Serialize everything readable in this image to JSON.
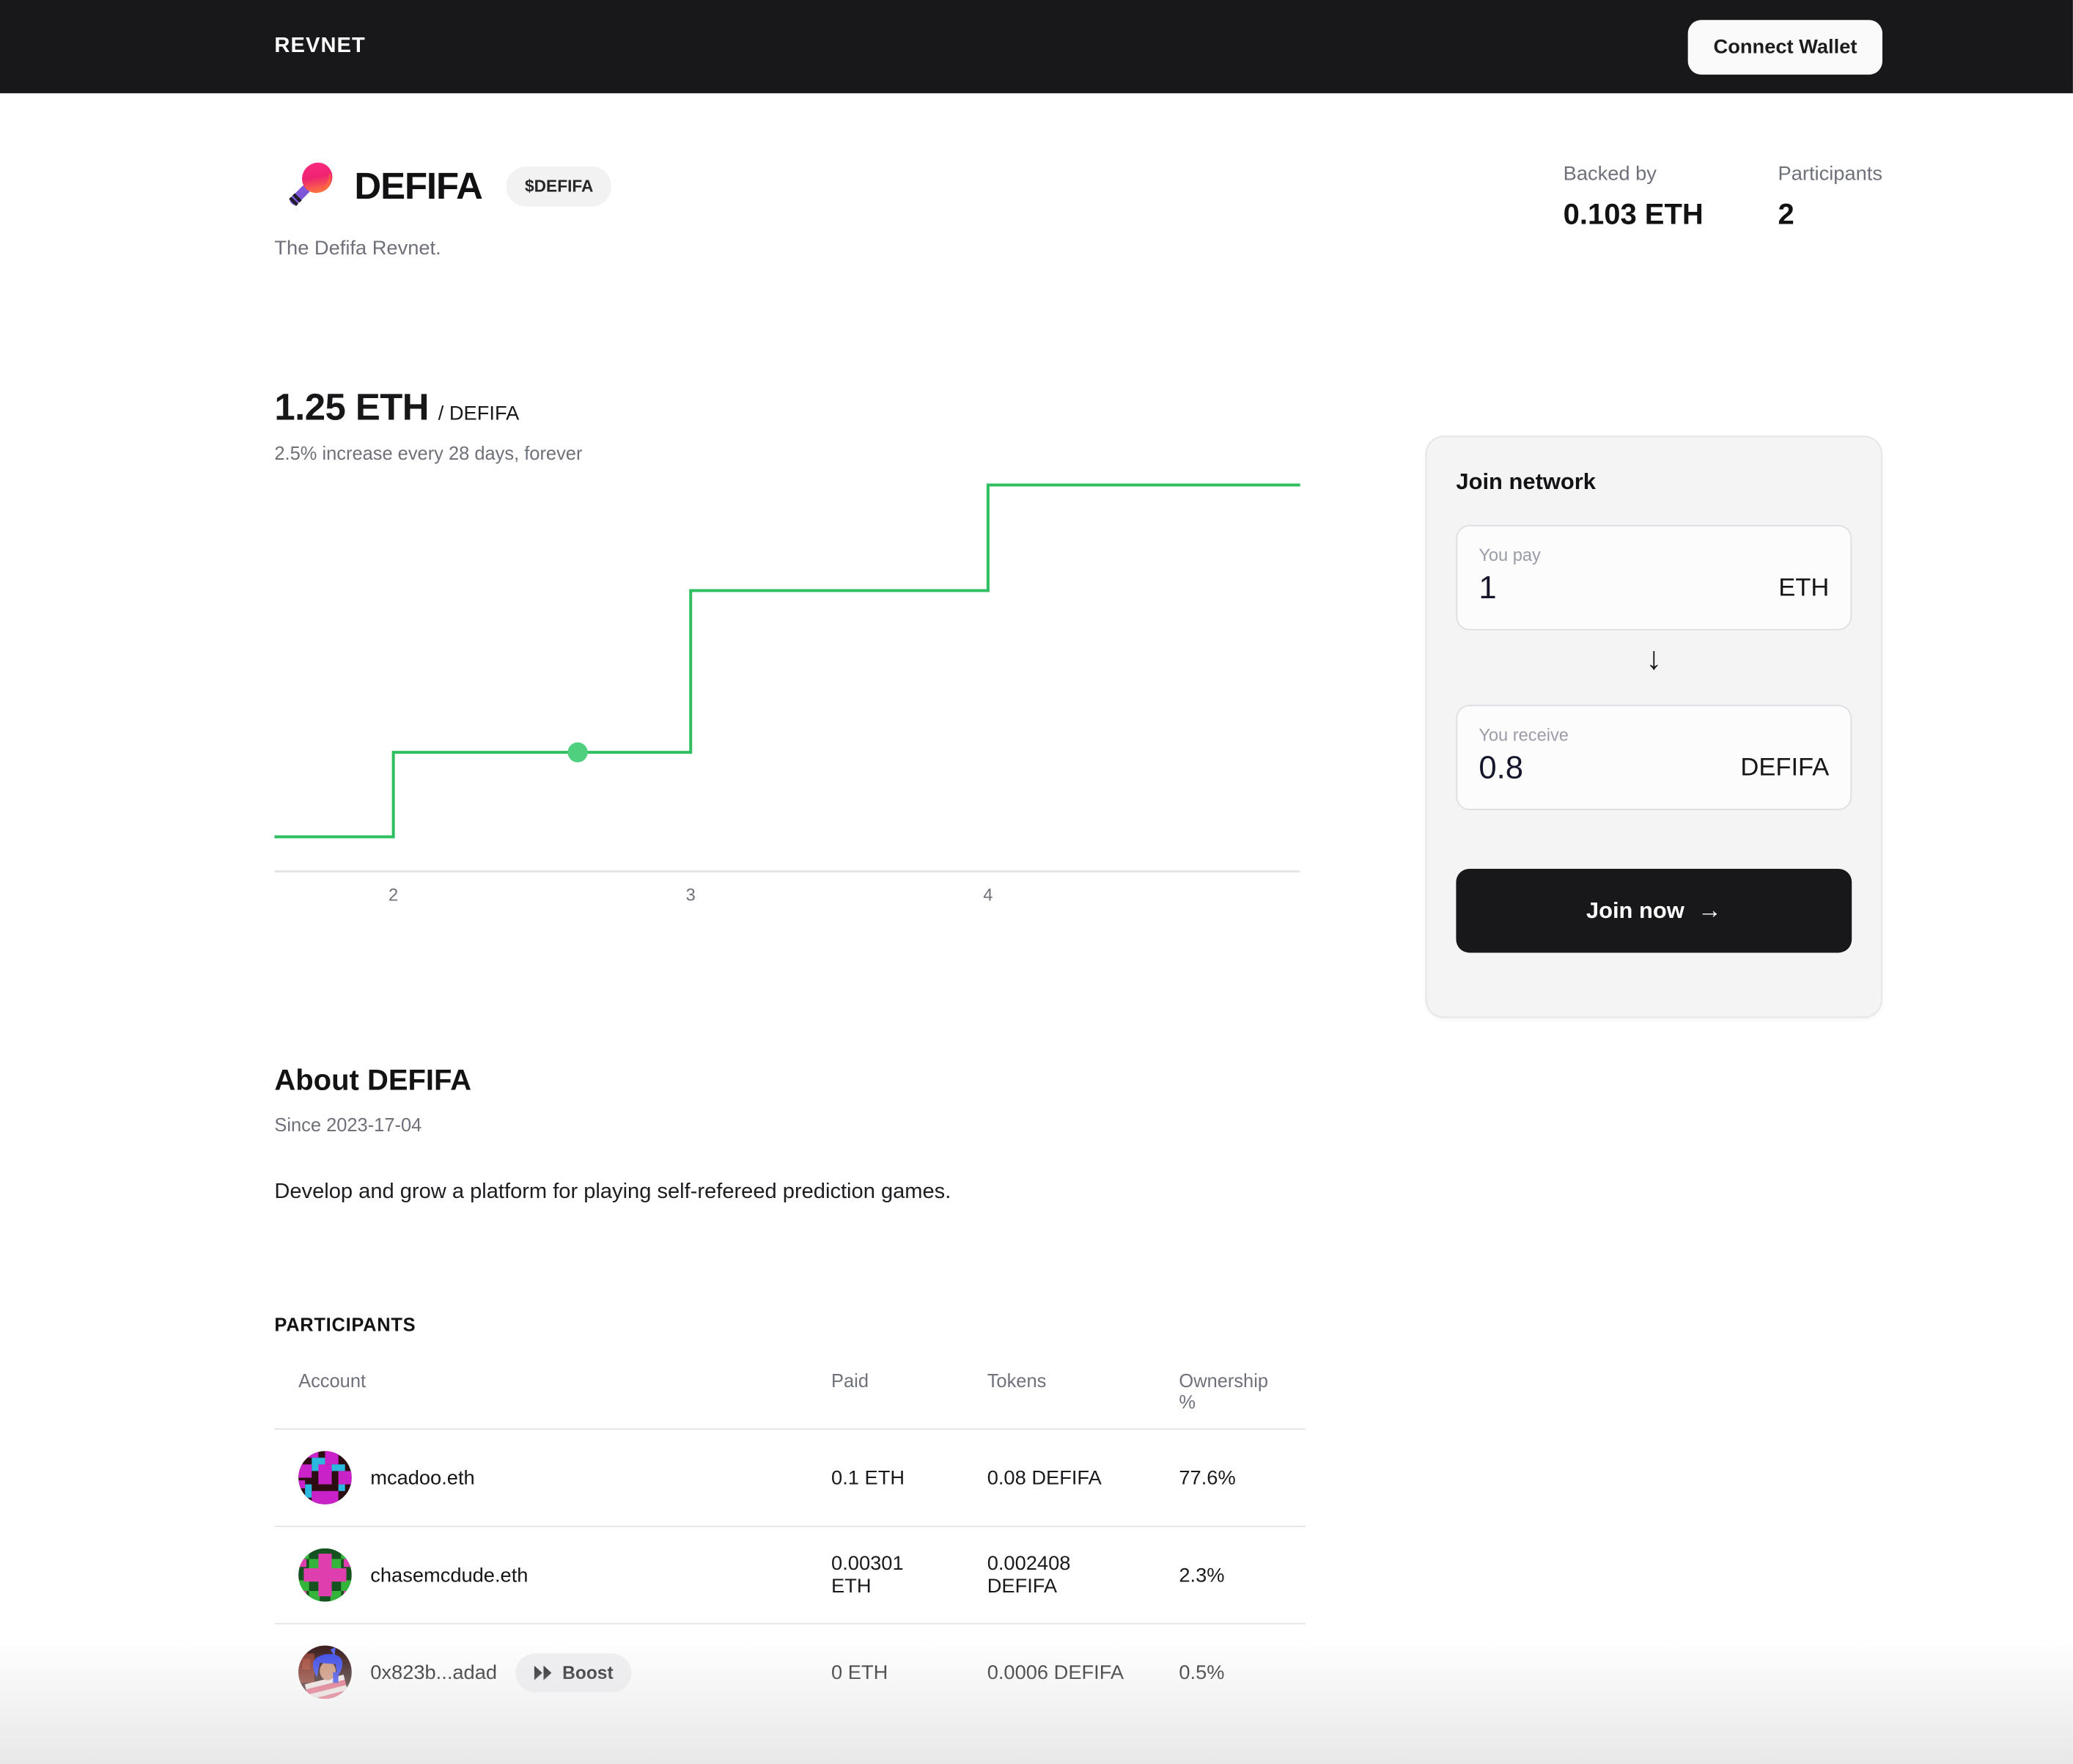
{
  "nav": {
    "brand": "REVNET",
    "connect_wallet_label": "Connect Wallet"
  },
  "project": {
    "name": "DEFIFA",
    "ticker_badge": "$DEFIFA",
    "tagline": "The Defifa Revnet.",
    "stats": [
      {
        "label": "Backed by",
        "value": "0.103 ETH"
      },
      {
        "label": "Participants",
        "value": "2"
      }
    ]
  },
  "chart": {
    "price_value": "1.25 ETH",
    "price_unit": "/ DEFIFA",
    "subtitle": "2.5% increase every 28 days, forever",
    "chart_data": {
      "type": "line",
      "line_shape": "step",
      "title": "1.25 ETH / DEFIFA",
      "subtitle": "2.5% increase every 28 days, forever",
      "x_domain": [
        1.6,
        5.05
      ],
      "x_ticks": [
        2,
        3,
        4
      ],
      "y_unit": "relative price level (normalized from pixels), current price 1.25 ETH per DEFIFA",
      "steps": [
        {
          "from_x": 1.6,
          "to_x": 2,
          "level": 0.0
        },
        {
          "from_x": 2,
          "to_x": 3,
          "level": 0.24
        },
        {
          "from_x": 3,
          "to_x": 4,
          "level": 0.7
        },
        {
          "from_x": 4,
          "to_x": 5.05,
          "level": 1.0
        }
      ],
      "marker": {
        "x": 2.62,
        "level": 0.24
      },
      "line_color": "#2fbf60",
      "marker_color": "#4fd07f",
      "grid": false,
      "legend_position": "none"
    }
  },
  "join_card": {
    "title": "Join network",
    "pay": {
      "label": "You pay",
      "value": "1",
      "currency": "ETH"
    },
    "receive": {
      "label": "You receive",
      "value": "0.8",
      "currency": "DEFIFA"
    },
    "arrow_down": "↓",
    "button_label": "Join now",
    "arrow_right": "→"
  },
  "about": {
    "title": "About DEFIFA",
    "since": "Since 2023-17-04",
    "description": "Develop and grow a platform for playing self-refereed prediction games."
  },
  "participants": {
    "section_title": "PARTICIPANTS",
    "columns": [
      "Account",
      "Paid",
      "Tokens",
      "Ownership %"
    ],
    "rows": [
      {
        "account": "mcadoo.eth",
        "paid": "0.1 ETH",
        "tokens": "0.08 DEFIFA",
        "ownership": "77.6%"
      },
      {
        "account": "chasemcdude.eth",
        "paid": "0.00301 ETH",
        "tokens": "0.002408 DEFIFA",
        "ownership": "2.3%"
      },
      {
        "account": "0x823b...adad",
        "paid": "0 ETH",
        "tokens": "0.0006 DEFIFA",
        "ownership": "0.5%",
        "boost_label": "Boost"
      }
    ]
  },
  "icons": {
    "logo": "paddle-icon",
    "boost": "fast-forward-icon",
    "avatars": [
      "pixel-magenta-cyan-avatar",
      "pixel-green-pink-avatar",
      "blue-hair-character-avatar"
    ]
  },
  "colors": {
    "nav_bg": "#18181b",
    "line_green": "#2fbf60",
    "marker_green": "#4fd07f",
    "card_bg": "#f4f4f5",
    "button_bg": "#18181b"
  }
}
